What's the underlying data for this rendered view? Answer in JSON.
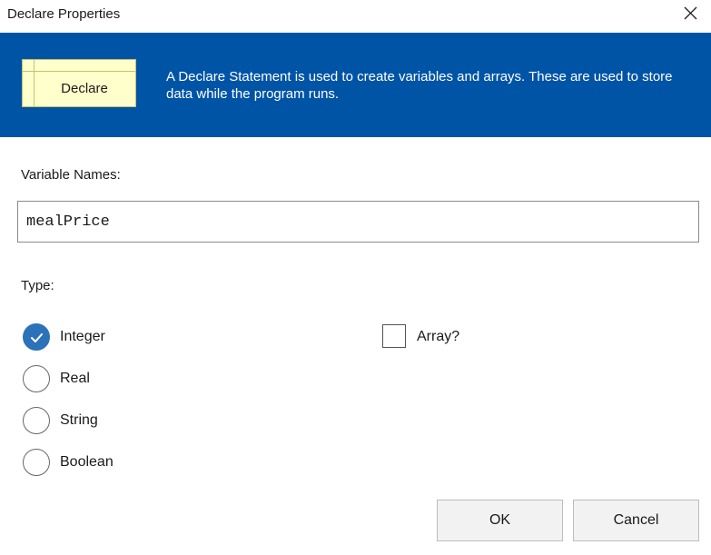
{
  "window": {
    "title": "Declare Properties",
    "close_icon": "close-icon"
  },
  "banner": {
    "shape_label": "Declare",
    "description": "A Declare Statement is used to create variables and arrays. These are used to store data while the program runs.",
    "background_color": "#0054a6",
    "shape_color": "#ffffcc"
  },
  "variables": {
    "label": "Variable Names:",
    "value": "mealPrice"
  },
  "type": {
    "label": "Type:",
    "selected": "Integer",
    "options": [
      {
        "label": "Integer",
        "checked": true
      },
      {
        "label": "Real",
        "checked": false
      },
      {
        "label": "String",
        "checked": false
      },
      {
        "label": "Boolean",
        "checked": false
      }
    ]
  },
  "array": {
    "label": "Array?",
    "checked": false
  },
  "buttons": {
    "ok_label": "OK",
    "cancel_label": "Cancel"
  },
  "colors": {
    "radio_checked": "#2b72b8"
  }
}
